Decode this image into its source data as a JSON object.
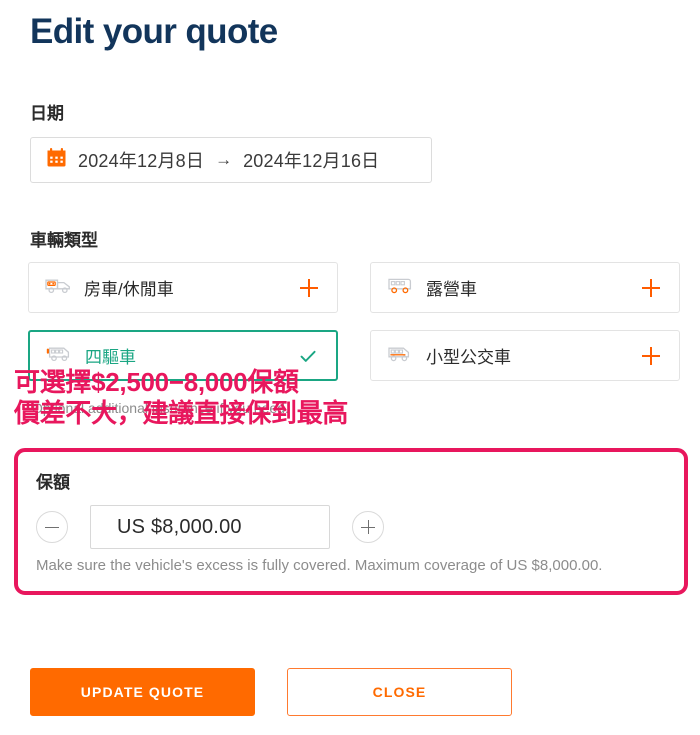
{
  "page_title": "Edit your quote",
  "colors": {
    "heading_navy": "#12355b",
    "accent_orange": "#ff6a00",
    "selected_teal": "#1aa683",
    "annotation_pink": "#e8175d"
  },
  "dates": {
    "label": "日期",
    "icon": "calendar-icon",
    "start": "2024年12月8日",
    "arrow": "→",
    "end": "2024年12月16日"
  },
  "vehicle": {
    "label": "車輛類型",
    "cards": [
      {
        "label": "房車/休閒車",
        "icon": "campervan-icon",
        "selected": false,
        "action": "+"
      },
      {
        "label": "露營車",
        "icon": "motorhome-icon",
        "selected": false,
        "action": "+"
      },
      {
        "label": "四驅車",
        "icon": "four-wheel-drive-icon",
        "selected": true,
        "action": "✓"
      },
      {
        "label": "小型公交車",
        "icon": "minibus-icon",
        "selected": false,
        "action": "+"
      }
    ]
  },
  "helper_text": "Optional additional insurance if you need.",
  "annotation": {
    "line1": "可選擇$2,500−8,000保額",
    "line2": "價差不大，建議直接保到最高"
  },
  "excess": {
    "title": "保額",
    "decrease_label": "−",
    "increase_label": "+",
    "value": "US $8,000.00",
    "note": "Make sure the vehicle's excess is fully covered. Maximum coverage of US $8,000.00."
  },
  "footer": {
    "update_label": "UPDATE QUOTE",
    "close_label": "CLOSE"
  }
}
